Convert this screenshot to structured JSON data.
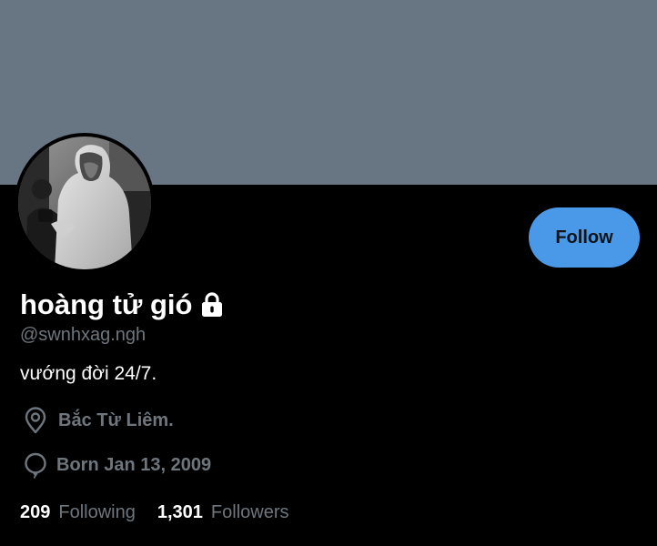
{
  "profile": {
    "display_name": "hoàng tử gió",
    "handle": "@swnhxag.ngh",
    "bio": "vướng đời 24/7.",
    "location": "Bắc Từ Liêm.",
    "birth": "Born Jan 13, 2009",
    "protected_icon": "lock-icon",
    "location_icon": "location-pin-icon",
    "birth_icon": "balloon-icon"
  },
  "actions": {
    "follow_label": "Follow"
  },
  "stats": {
    "following_count": "209",
    "following_label": "Following",
    "followers_count": "1,301",
    "followers_label": "Followers"
  },
  "colors": {
    "banner": "#687684",
    "background": "#000000",
    "accent": "#4a99e9",
    "secondary_text": "#6e767d",
    "primary_text": "#ffffff"
  }
}
